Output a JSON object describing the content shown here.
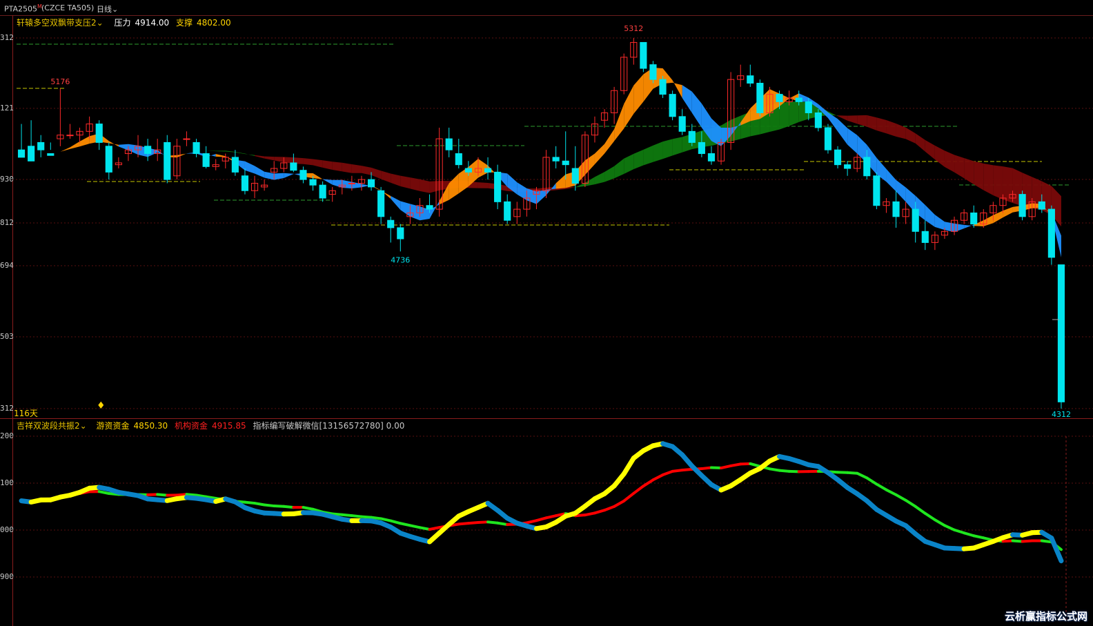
{
  "topbar": {
    "symbol": "PTA2505",
    "sup": "M",
    "code": "(CZCE TA505)",
    "period": "日线"
  },
  "main_legend": {
    "indicator": "轩辕多空双飘带支压2",
    "pressure_label": "压力",
    "pressure_value": "4914.00",
    "support_label": "支撑",
    "support_value": "4802.00"
  },
  "sub_legend": {
    "indicator": "吉祥双波段共振2",
    "hot_label": "游资资金",
    "hot_value": "4850.30",
    "inst_label": "机构资金",
    "inst_value": "4915.85",
    "ad_text": "指标编写破解微信[13156572780] 0.00"
  },
  "annotations": {
    "high1": "5176",
    "high2": "5312",
    "low1": "4736",
    "last_low": "4312",
    "days": "116天"
  },
  "watermark": "云析赢指标公式网",
  "colors": {
    "bull": "#ff2a2a",
    "bear": "#00e5ee",
    "support_line": "#c8c800",
    "green_line": "#2e9e2e",
    "yellow": "#ffff00",
    "blue": "#0a84c8",
    "lime": "#1fe61f",
    "red": "#ff0000"
  },
  "chart_data": [
    {
      "type": "candlestick",
      "y_ticks": [
        "312",
        "121",
        "930",
        "812",
        "694",
        "503",
        "312"
      ],
      "ylim": [
        4312,
        5312
      ],
      "candles": [
        [
          5010,
          5080,
          5000,
          4990
        ],
        [
          5020,
          5090,
          5010,
          4980
        ],
        [
          5030,
          5050,
          4990,
          5010
        ],
        [
          5000,
          5010,
          5030,
          4995
        ],
        [
          5040,
          5176,
          5020,
          5050
        ],
        [
          5050,
          5080,
          5040,
          5050
        ],
        [
          5050,
          5070,
          5030,
          5060
        ],
        [
          5060,
          5100,
          5040,
          5080
        ],
        [
          5080,
          5090,
          5010,
          5030
        ],
        [
          5020,
          5030,
          4930,
          4950
        ],
        [
          4970,
          4990,
          4960,
          4975
        ],
        [
          5000,
          5020,
          4980,
          5010
        ],
        [
          5010,
          5050,
          4990,
          5020
        ],
        [
          5020,
          5040,
          4980,
          5000
        ],
        [
          5000,
          5040,
          4980,
          5010
        ],
        [
          5030,
          5050,
          4920,
          4930
        ],
        [
          4940,
          5040,
          4930,
          5020
        ],
        [
          5040,
          5060,
          5020,
          5040
        ],
        [
          5030,
          5040,
          4990,
          5000
        ],
        [
          5000,
          5020,
          4960,
          4965
        ],
        [
          4965,
          4985,
          4955,
          4970
        ],
        [
          4980,
          5000,
          4960,
          4990
        ],
        [
          4990,
          5010,
          4940,
          4950
        ],
        [
          4940,
          4960,
          4890,
          4900
        ],
        [
          4900,
          4940,
          4880,
          4920
        ],
        [
          4910,
          4930,
          4900,
          4915
        ],
        [
          4950,
          4980,
          4930,
          4960
        ],
        [
          4960,
          4990,
          4950,
          4975
        ],
        [
          4975,
          5000,
          4950,
          4955
        ],
        [
          4955,
          4965,
          4920,
          4930
        ],
        [
          4930,
          4940,
          4900,
          4915
        ],
        [
          4915,
          4925,
          4870,
          4880
        ],
        [
          4890,
          4910,
          4870,
          4900
        ],
        [
          4910,
          4930,
          4890,
          4915
        ],
        [
          4920,
          4940,
          4900,
          4920
        ],
        [
          4920,
          4940,
          4900,
          4930
        ],
        [
          4930,
          4950,
          4900,
          4910
        ],
        [
          4900,
          4910,
          4810,
          4830
        ],
        [
          4820,
          4830,
          4760,
          4800
        ],
        [
          4800,
          4810,
          4736,
          4770
        ],
        [
          4830,
          4860,
          4810,
          4840
        ],
        [
          4840,
          4880,
          4830,
          4860
        ],
        [
          4860,
          4890,
          4840,
          4850
        ],
        [
          4850,
          5070,
          4830,
          5040
        ],
        [
          5040,
          5070,
          4990,
          5010
        ],
        [
          5000,
          5040,
          4960,
          4970
        ],
        [
          4960,
          4980,
          4940,
          4950
        ],
        [
          4950,
          4990,
          4940,
          4960
        ],
        [
          4960,
          4990,
          4930,
          4950
        ],
        [
          4950,
          4970,
          4850,
          4870
        ],
        [
          4870,
          4890,
          4810,
          4820
        ],
        [
          4830,
          4870,
          4810,
          4850
        ],
        [
          4850,
          4900,
          4830,
          4880
        ],
        [
          4890,
          4910,
          4850,
          4900
        ],
        [
          4900,
          5010,
          4880,
          4990
        ],
        [
          4990,
          5020,
          4960,
          4980
        ],
        [
          4980,
          5060,
          4930,
          4970
        ],
        [
          4960,
          5020,
          4900,
          4920
        ],
        [
          4920,
          5060,
          4910,
          5050
        ],
        [
          5050,
          5100,
          5030,
          5080
        ],
        [
          5090,
          5120,
          5070,
          5110
        ],
        [
          5110,
          5180,
          5080,
          5170
        ],
        [
          5170,
          5270,
          5160,
          5260
        ],
        [
          5260,
          5312,
          5240,
          5300
        ],
        [
          5300,
          5290,
          5220,
          5230
        ],
        [
          5240,
          5250,
          5190,
          5200
        ],
        [
          5200,
          5210,
          5150,
          5160
        ],
        [
          5160,
          5170,
          5090,
          5100
        ],
        [
          5100,
          5120,
          5050,
          5060
        ],
        [
          5060,
          5080,
          5020,
          5030
        ],
        [
          5030,
          5060,
          4990,
          5000
        ],
        [
          5000,
          5020,
          4970,
          4980
        ],
        [
          4980,
          5040,
          4970,
          5030
        ],
        [
          5030,
          5220,
          5010,
          5200
        ],
        [
          5200,
          5240,
          5180,
          5210
        ],
        [
          5210,
          5240,
          5180,
          5190
        ],
        [
          5190,
          5200,
          5100,
          5110
        ],
        [
          5110,
          5180,
          5100,
          5160
        ],
        [
          5160,
          5170,
          5120,
          5140
        ],
        [
          5140,
          5170,
          5130,
          5150
        ],
        [
          5150,
          5170,
          5130,
          5140
        ],
        [
          5140,
          5150,
          5090,
          5110
        ],
        [
          5110,
          5120,
          5060,
          5070
        ],
        [
          5070,
          5080,
          5000,
          5010
        ],
        [
          5010,
          5020,
          4960,
          4970
        ],
        [
          4970,
          4980,
          4940,
          4960
        ],
        [
          4960,
          5000,
          4950,
          4990
        ],
        [
          4990,
          5010,
          4930,
          4940
        ],
        [
          4940,
          4950,
          4850,
          4860
        ],
        [
          4860,
          4880,
          4840,
          4870
        ],
        [
          4870,
          4900,
          4800,
          4830
        ],
        [
          4830,
          4870,
          4810,
          4850
        ],
        [
          4850,
          4870,
          4760,
          4790
        ],
        [
          4790,
          4820,
          4740,
          4760
        ],
        [
          4760,
          4790,
          4740,
          4780
        ],
        [
          4780,
          4800,
          4770,
          4790
        ],
        [
          4790,
          4830,
          4780,
          4820
        ],
        [
          4820,
          4850,
          4810,
          4840
        ],
        [
          4840,
          4860,
          4800,
          4810
        ],
        [
          4810,
          4850,
          4800,
          4840
        ],
        [
          4840,
          4870,
          4820,
          4860
        ],
        [
          4860,
          4890,
          4840,
          4880
        ],
        [
          4880,
          4900,
          4870,
          4890
        ],
        [
          4890,
          4900,
          4820,
          4830
        ],
        [
          4830,
          4880,
          4820,
          4870
        ],
        [
          4870,
          4890,
          4840,
          4850
        ],
        [
          4850,
          4860,
          4700,
          4720
        ],
        [
          4700,
          4680,
          4312,
          4330
        ]
      ]
    },
    {
      "type": "line",
      "y_ticks": [
        "200",
        "100",
        "000",
        "900"
      ],
      "series": []
    }
  ]
}
